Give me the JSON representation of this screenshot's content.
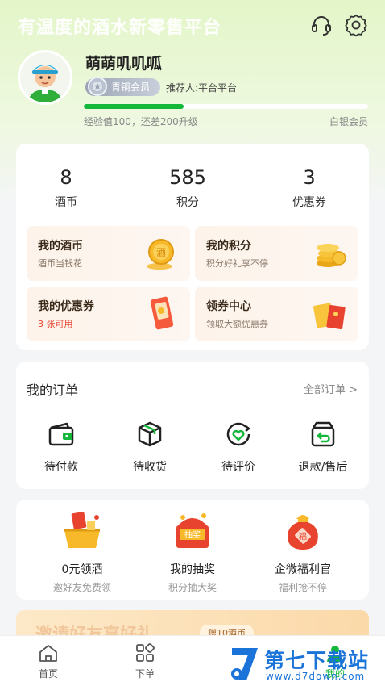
{
  "header": {
    "slogan": "有温度的酒水新零售平台",
    "icons": [
      "headset-icon",
      "gear-icon"
    ]
  },
  "profile": {
    "username": "萌萌叽叽呱",
    "member_level": "青铜会员",
    "referrer": "推荐人:平台平台",
    "exp_text": "经验值100，还差200升级",
    "next_level": "银会员",
    "next_level_full": "白银会员",
    "progress_fraction": 0.35
  },
  "stats": [
    {
      "value": "8",
      "label": "酒币"
    },
    {
      "value": "585",
      "label": "积分"
    },
    {
      "value": "3",
      "label": "优惠券"
    }
  ],
  "tiles": [
    {
      "title": "我的酒币",
      "subtitle": "酒币当钱花",
      "icon": "coin-icon"
    },
    {
      "title": "我的积分",
      "subtitle": "积分好礼享不停",
      "icon": "points-stack-icon"
    },
    {
      "title": "我的优惠券",
      "subtitle": "3 张可用",
      "icon": "coupon-ticket-icon"
    },
    {
      "title": "领券中心",
      "subtitle": "领取大额优惠券",
      "icon": "coupon-center-icon"
    }
  ],
  "orders": {
    "title": "我的订单",
    "all_label": "全部订单 >",
    "items": [
      {
        "label": "待付款",
        "icon": "wallet-icon"
      },
      {
        "label": "待收货",
        "icon": "box-icon"
      },
      {
        "label": "待评价",
        "icon": "review-icon"
      },
      {
        "label": "退款/售后",
        "icon": "refund-icon"
      }
    ]
  },
  "promos": [
    {
      "title": "0元领酒",
      "subtitle": "邀好友免费领",
      "icon": "gift-basket-icon"
    },
    {
      "title": "我的抽奖",
      "subtitle": "积分抽大奖",
      "icon": "lottery-chest-icon"
    },
    {
      "title": "企微福利官",
      "subtitle": "福利抢不停",
      "icon": "lucky-bag-icon"
    }
  ],
  "invite_banner": {
    "text": "邀请好友享好礼",
    "tag": "赠10酒币"
  },
  "tabbar": [
    {
      "label": "首页",
      "icon": "home-icon"
    },
    {
      "label": "下单",
      "icon": "grid-icon"
    },
    {
      "label": "我的",
      "icon": "user-icon",
      "active": true
    }
  ],
  "watermark": {
    "name": "第七下载站",
    "url": "www.d7down.com"
  },
  "colors": {
    "accent_green": "#13b83a",
    "coupon_red": "#e8432e"
  }
}
